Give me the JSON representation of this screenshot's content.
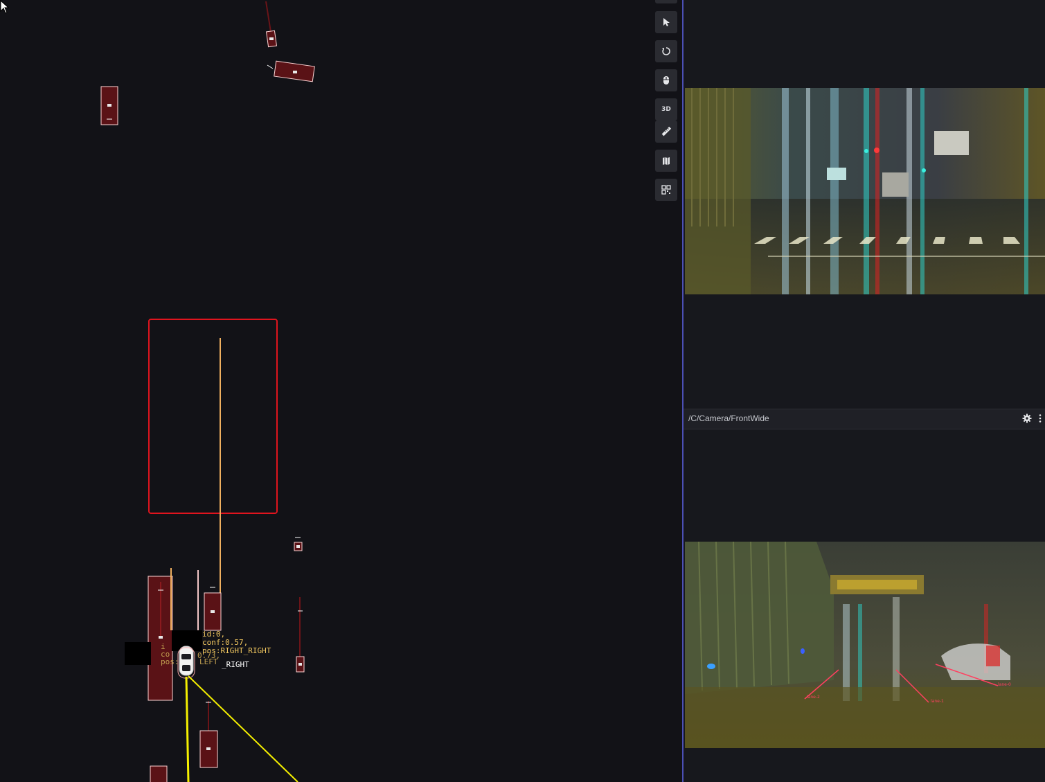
{
  "scene": {
    "label_right": {
      "id": "id:0,",
      "conf": "conf:0.57,",
      "pos": "pos:RIGHT_RIGHT",
      "pos_under": "_RIGHT"
    },
    "label_left": {
      "id": "i",
      "conf": "co",
      "conf_tail": "0.73,",
      "pos": "pos:",
      "pos_tail": "LEFT"
    }
  },
  "toolbar": {
    "select_icon": "pointer-icon",
    "rotate_icon": "rotate-icon",
    "mouse_icon": "mouse-icon",
    "view_3d_label": "3D",
    "ruler_icon": "ruler-icon",
    "map_icon": "map-icon",
    "qr_icon": "qr-icon"
  },
  "panels": {
    "front_wide_title": "/C/Camera/FrontWide",
    "settings_icon": "gear-icon",
    "more_icon": "more-vertical-icon"
  },
  "camera_lanes": {
    "lane_a": "lane-2",
    "lane_b": "lane-1",
    "lane_c": "lane-0"
  },
  "colors": {
    "background": "#121217",
    "object_fill": "#5a1216",
    "highlight_box": "#e0141e",
    "trajectory": "#f0b060",
    "ray": "#f5f000",
    "label_text": "#f4c960",
    "divider": "#4b4fb4"
  }
}
